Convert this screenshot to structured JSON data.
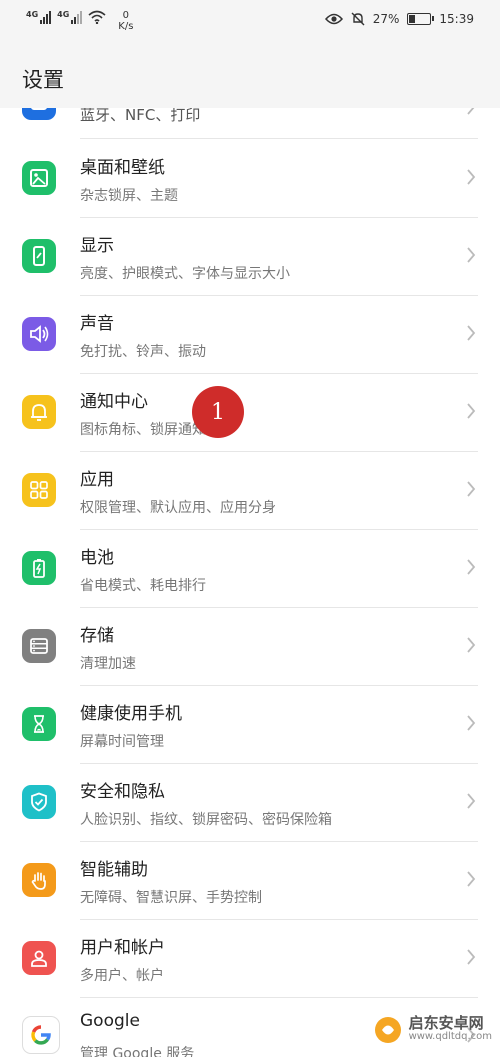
{
  "status_bar": {
    "signal1_label": "4G",
    "signal2_label": "4G",
    "speed_value": "0",
    "speed_unit": "K/s",
    "battery": "27%",
    "battery_level": 0.27,
    "time": "15:39"
  },
  "header": {
    "title": "设置"
  },
  "items": [
    {
      "title": "蓝牙、NFC、打印",
      "subtitle": "",
      "icon": "bluetooth-icon",
      "color": "#1e6fe0"
    },
    {
      "title": "桌面和壁纸",
      "subtitle": "杂志锁屏、主题",
      "icon": "wallpaper-icon",
      "color": "#1fbf6a"
    },
    {
      "title": "显示",
      "subtitle": "亮度、护眼模式、字体与显示大小",
      "icon": "display-icon",
      "color": "#1fbf6a"
    },
    {
      "title": "声音",
      "subtitle": "免打扰、铃声、振动",
      "icon": "sound-icon",
      "color": "#7b5be6"
    },
    {
      "title": "通知中心",
      "subtitle": "图标角标、锁屏通知",
      "icon": "bell-icon",
      "color": "#f6c21c"
    },
    {
      "title": "应用",
      "subtitle": "权限管理、默认应用、应用分身",
      "icon": "apps-icon",
      "color": "#f6c21c"
    },
    {
      "title": "电池",
      "subtitle": "省电模式、耗电排行",
      "icon": "battery-icon",
      "color": "#1fbf6a"
    },
    {
      "title": "存储",
      "subtitle": "清理加速",
      "icon": "storage-icon",
      "color": "#808080"
    },
    {
      "title": "健康使用手机",
      "subtitle": "屏幕时间管理",
      "icon": "hourglass-icon",
      "color": "#1fbf6a"
    },
    {
      "title": "安全和隐私",
      "subtitle": "人脸识别、指纹、锁屏密码、密码保险箱",
      "icon": "shield-icon",
      "color": "#1fc0c8"
    },
    {
      "title": "智能辅助",
      "subtitle": "无障碍、智慧识屏、手势控制",
      "icon": "hand-icon",
      "color": "#f49a1a"
    },
    {
      "title": "用户和帐户",
      "subtitle": "多用户、帐户",
      "icon": "user-icon",
      "color": "#ef5350"
    },
    {
      "title": "Google",
      "subtitle": "管理 Google 服务",
      "icon": "google-icon",
      "color": "#ffffff"
    }
  ],
  "annotation": {
    "label": "1",
    "color": "#cf2c2a"
  },
  "watermark": {
    "name": "启东安卓网",
    "url": "www.qdltdq.com"
  }
}
